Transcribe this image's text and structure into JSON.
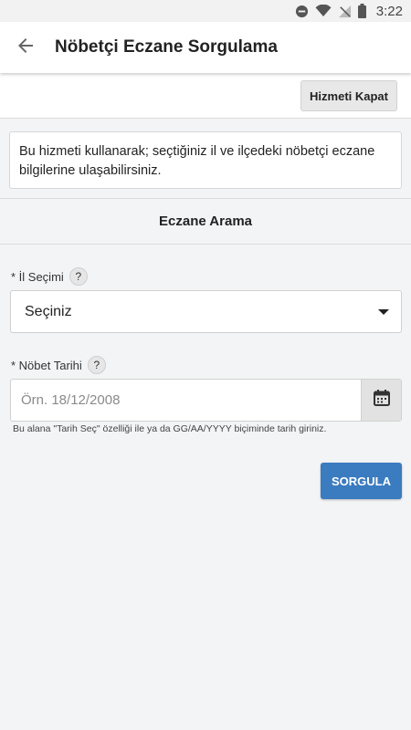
{
  "status_bar": {
    "time": "3:22",
    "icons": [
      "do-not-disturb-icon",
      "wifi-icon",
      "no-signal-icon",
      "battery-icon"
    ]
  },
  "app_bar": {
    "back_icon": "arrow-left-icon",
    "title": "Nöbetçi Eczane Sorgulama"
  },
  "actions": {
    "close_service_label": "Hizmeti Kapat"
  },
  "info": {
    "text": "Bu hizmeti kullanarak; seçtiğiniz il ve ilçedeki nöbetçi eczane bilgilerine ulaşabilirsiniz."
  },
  "section": {
    "title": "Eczane Arama"
  },
  "form": {
    "province": {
      "label": "* İl Seçimi",
      "help": "?",
      "selected": "Seçiniz"
    },
    "date": {
      "label": "* Nöbet Tarihi",
      "help": "?",
      "placeholder": "Örn. 18/12/2008",
      "value": "",
      "hint": "Bu alana \"Tarih Seç\" özelliği ile ya da GG/AA/YYYY biçiminde tarih giriniz.",
      "calendar_icon": "calendar-icon"
    },
    "submit_label": "SORGULA"
  },
  "colors": {
    "primary": "#3b7bbf",
    "background": "#f3f4f6"
  }
}
